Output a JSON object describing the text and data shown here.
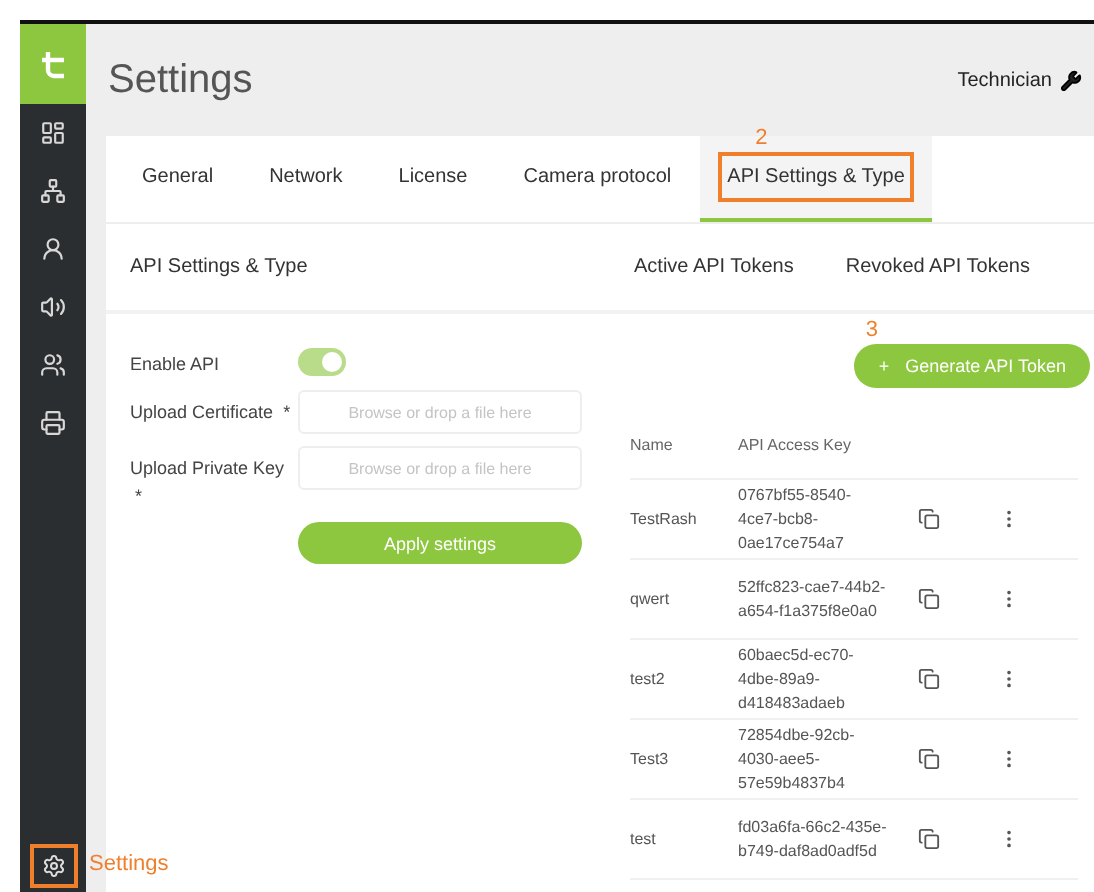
{
  "page": {
    "title": "Settings",
    "user": "Technician"
  },
  "tabs": [
    {
      "label": "General",
      "selected": false
    },
    {
      "label": "Network",
      "selected": false
    },
    {
      "label": "License",
      "selected": false
    },
    {
      "label": "Camera protocol",
      "selected": false
    },
    {
      "label": "API Settings & Type",
      "selected": true
    }
  ],
  "api_settings": {
    "heading": "API Settings & Type",
    "enable_label": "Enable API",
    "enable_on": true,
    "uploads": [
      {
        "label": "Upload Certificate",
        "required": "*",
        "placeholder": "Browse or drop a file here"
      },
      {
        "label": "Upload Private Key",
        "required": "*",
        "placeholder": "Browse or drop a file here"
      }
    ],
    "apply_button": "Apply settings"
  },
  "token_tabs": [
    {
      "label": "Active API Tokens"
    },
    {
      "label": "Revoked API Tokens"
    }
  ],
  "generate_button": {
    "icon": "+",
    "label": "Generate API Token"
  },
  "table": {
    "columns": [
      "Name",
      "API Access Key"
    ],
    "rows": [
      {
        "name": "TestRash",
        "key": "0767bf55-8540-4ce7-bcb8-0ae17ce754a7"
      },
      {
        "name": "qwert",
        "key": "52ffc823-cae7-44b2-a654-f1a375f8e0a0"
      },
      {
        "name": "test2",
        "key": "60baec5d-ec70-4dbe-89a9-d418483adaeb"
      },
      {
        "name": "Test3",
        "key": "72854dbe-92cb-4030-aee5-57e59b4837b4"
      },
      {
        "name": "test",
        "key": "fd03a6fa-66c2-435e-b749-daf8ad0adf5d"
      }
    ]
  },
  "annotations": {
    "tab_step": "2",
    "generate_step": "3",
    "settings_label": "Settings"
  }
}
